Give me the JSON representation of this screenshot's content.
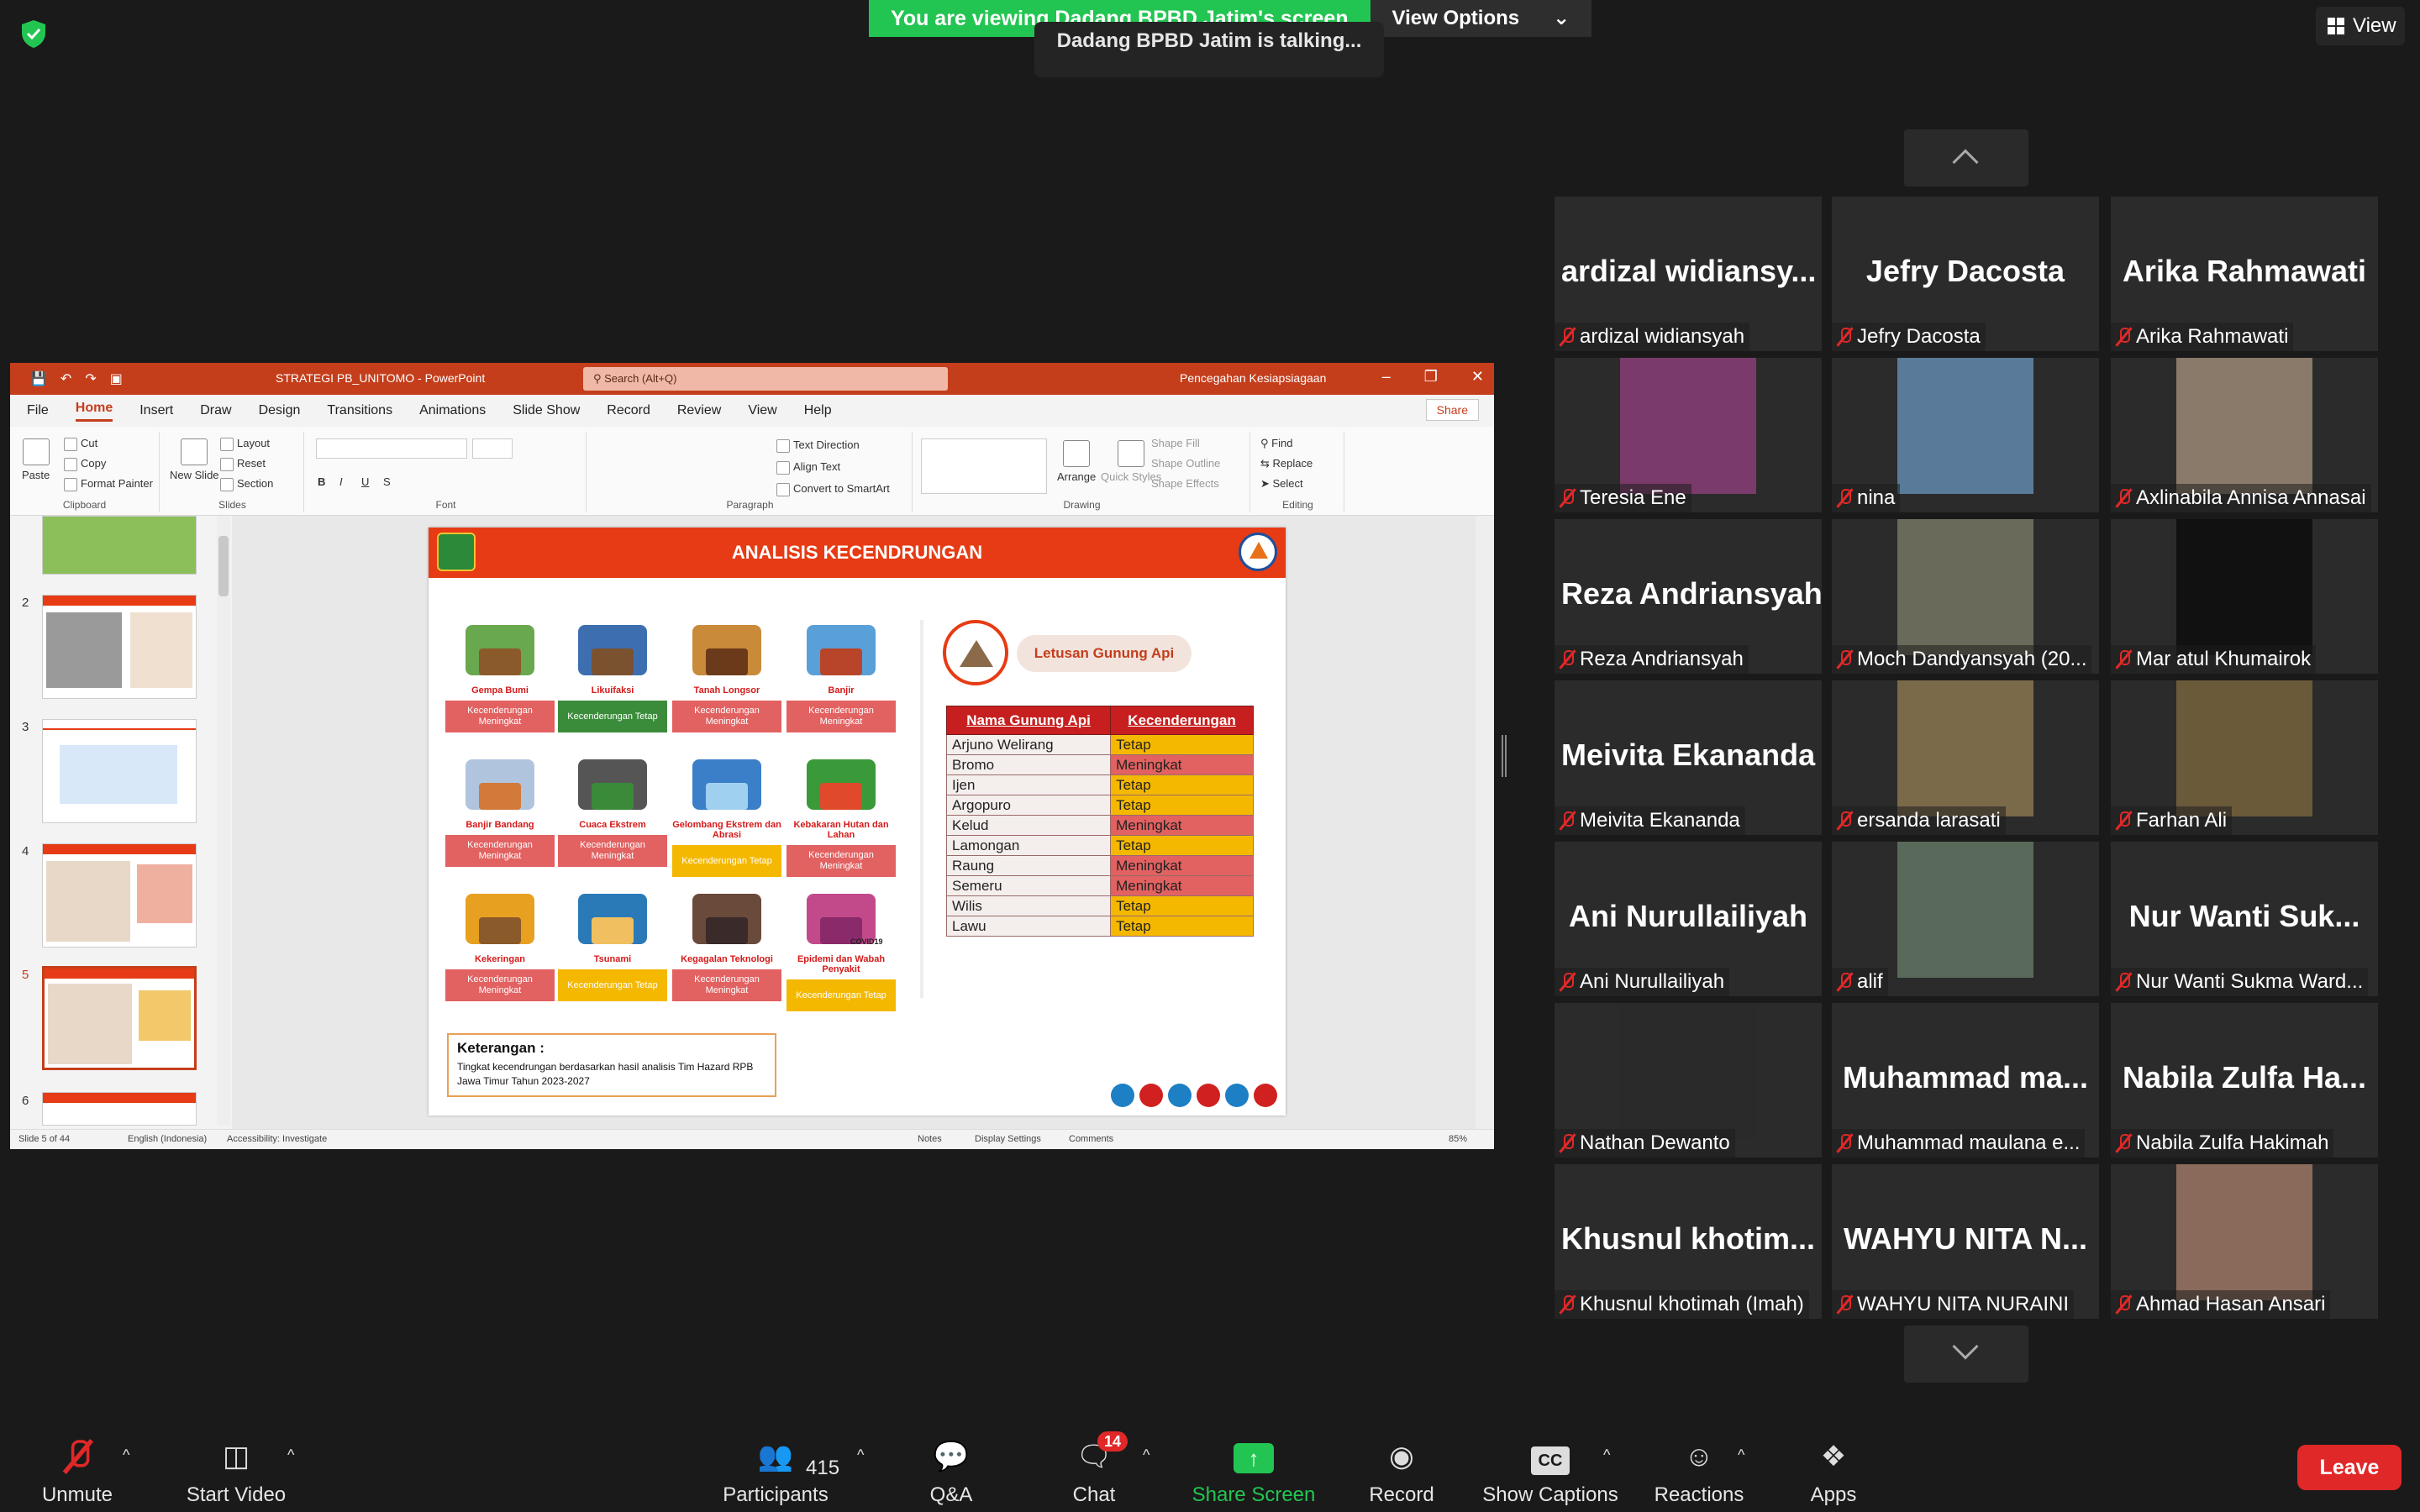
{
  "banner": {
    "viewing": "You are viewing Dadang BPBD Jatim's screen",
    "view_options": "View Options",
    "talking": "Dadang BPBD Jatim is talking..."
  },
  "view_button": "View",
  "ppt": {
    "doc_title": "STRATEGI PB_UNITOMO  -  PowerPoint",
    "search_placeholder": "Search (Alt+Q)",
    "user": "Pencegahan Kesiapsiagaan",
    "tabs": [
      "File",
      "Home",
      "Insert",
      "Draw",
      "Design",
      "Transitions",
      "Animations",
      "Slide Show",
      "Record",
      "Review",
      "View",
      "Help"
    ],
    "share": "Share",
    "ribbon": {
      "paste": "Paste",
      "cut": "Cut",
      "copy": "Copy",
      "format_painter": "Format Painter",
      "clipboard": "Clipboard",
      "new_slide": "New Slide",
      "layout": "Layout",
      "reset": "Reset",
      "section": "Section",
      "slides": "Slides",
      "font": "Font",
      "text_direction": "Text Direction",
      "align_text": "Align Text",
      "convert_smartart": "Convert to SmartArt",
      "paragraph": "Paragraph",
      "arrange": "Arrange",
      "quick_styles": "Quick Styles",
      "shape_fill": "Shape Fill",
      "shape_outline": "Shape Outline",
      "shape_effects": "Shape Effects",
      "drawing": "Drawing",
      "find": "Find",
      "replace": "Replace",
      "select": "Select",
      "editing": "Editing"
    },
    "thumb_numbers": [
      "2",
      "3",
      "4",
      "5",
      "6"
    ],
    "status": {
      "slide": "Slide 5 of 44",
      "language": "English (Indonesia)",
      "accessibility": "Accessibility: Investigate",
      "notes": "Notes",
      "display": "Display Settings",
      "comments": "Comments",
      "zoom": "85%"
    }
  },
  "slide": {
    "title": "ANALISIS KECENDRUNGAN",
    "hazards": [
      {
        "name": "Gempa Bumi",
        "tag": "Kecenderungan Meningkat",
        "color": "#e26161"
      },
      {
        "name": "Likuifaksi",
        "tag": "Kecenderungan Tetap",
        "color": "#3a8c3a"
      },
      {
        "name": "Tanah Longsor",
        "tag": "Kecenderungan Meningkat",
        "color": "#e26161"
      },
      {
        "name": "Banjir",
        "tag": "Kecenderungan Meningkat",
        "color": "#e26161"
      },
      {
        "name": "Banjir Bandang",
        "tag": "Kecenderungan Meningkat",
        "color": "#e26161"
      },
      {
        "name": "Cuaca Ekstrem",
        "tag": "Kecenderungan Meningkat",
        "color": "#e26161"
      },
      {
        "name": "Gelombang Ekstrem dan Abrasi",
        "tag": "Kecenderungan Tetap",
        "color": "#f5b800"
      },
      {
        "name": "Kebakaran Hutan dan Lahan",
        "tag": "Kecenderungan Meningkat",
        "color": "#e26161"
      },
      {
        "name": "Kekeringan",
        "tag": "Kecenderungan Meningkat",
        "color": "#e26161"
      },
      {
        "name": "Tsunami",
        "tag": "Kecenderungan Tetap",
        "color": "#f5b800"
      },
      {
        "name": "Kegagalan Teknologi",
        "tag": "Kecenderungan Meningkat",
        "color": "#e26161"
      },
      {
        "name": "Epidemi dan Wabah Penyakit",
        "tag": "Kecenderungan Tetap",
        "color": "#f5b800"
      }
    ],
    "covid_label": "COVID19",
    "volcano_label": "Letusan Gunung Api",
    "table": {
      "headers": [
        "Nama Gunung Api",
        "Kecenderungan"
      ],
      "rows": [
        {
          "name": "Arjuno Welirang",
          "trend": "Tetap",
          "color": "#f5b800"
        },
        {
          "name": "Bromo",
          "trend": "Meningkat",
          "color": "#e26161"
        },
        {
          "name": "Ijen",
          "trend": "Tetap",
          "color": "#f5b800"
        },
        {
          "name": "Argopuro",
          "trend": "Tetap",
          "color": "#f5b800"
        },
        {
          "name": "Kelud",
          "trend": "Meningkat",
          "color": "#e26161"
        },
        {
          "name": "Lamongan",
          "trend": "Tetap",
          "color": "#f5b800"
        },
        {
          "name": "Raung",
          "trend": "Meningkat",
          "color": "#e26161"
        },
        {
          "name": "Semeru",
          "trend": "Meningkat",
          "color": "#e26161"
        },
        {
          "name": "Wilis",
          "trend": "Tetap",
          "color": "#f5b800"
        },
        {
          "name": "Lawu",
          "trend": "Tetap",
          "color": "#f5b800"
        }
      ]
    },
    "keterangan_title": "Keterangan :",
    "keterangan_text": "Tingkat kecendrungan berdasarkan hasil analisis Tim Hazard RPB Jawa Timur Tahun 2023-2027"
  },
  "participants": [
    {
      "big": "ardizal widiansy...",
      "label": "ardizal widiansyah"
    },
    {
      "big": "Jefry Dacosta",
      "label": "Jefry Dacosta"
    },
    {
      "big": "Arika Rahmawati",
      "label": "Arika Rahmawati"
    },
    {
      "label": "Teresia Ene",
      "video": "#7a3a6a"
    },
    {
      "label": "nina",
      "video": "#5a7a9a"
    },
    {
      "label": "Axlinabila Annisa Annasai",
      "video": "#8a7a6a"
    },
    {
      "big": "Reza Andriansyah",
      "label": "Reza Andriansyah"
    },
    {
      "label": "Moch Dandyansyah (20...",
      "video": "#6a6a5a"
    },
    {
      "label": "Mar atul Khumairok",
      "video": "#111111"
    },
    {
      "big": "Meivita Ekananda",
      "label": "Meivita Ekananda"
    },
    {
      "label": "ersanda larasati",
      "video": "#7a6a4a"
    },
    {
      "label": "Farhan Ali",
      "video": "#6a5a3a"
    },
    {
      "big": "Ani Nurullailiyah",
      "label": "Ani Nurullailiyah"
    },
    {
      "label": "alif",
      "video": "#5a6a5a"
    },
    {
      "big": "Nur Wanti Suk...",
      "label": "Nur Wanti Sukma Ward..."
    },
    {
      "label": "Nathan Dewanto",
      "video": "#2a2a2a"
    },
    {
      "big": "Muhammad ma...",
      "label": "Muhammad maulana e..."
    },
    {
      "big": "Nabila Zulfa Ha...",
      "label": "Nabila Zulfa Hakimah"
    },
    {
      "big": "Khusnul khotim...",
      "label": "Khusnul khotimah (Imah)"
    },
    {
      "big": "WAHYU NITA N...",
      "label": "WAHYU NITA NURAINI"
    },
    {
      "label": "Ahmad Hasan Ansari",
      "video": "#8a6a5a"
    }
  ],
  "toolbar": {
    "unmute": "Unmute",
    "start_video": "Start Video",
    "participants": "Participants",
    "participant_count": "415",
    "qa": "Q&A",
    "chat": "Chat",
    "chat_badge": "14",
    "share_screen": "Share Screen",
    "record": "Record",
    "captions": "Show Captions",
    "reactions": "Reactions",
    "apps": "Apps",
    "leave": "Leave",
    "cc": "CC"
  }
}
